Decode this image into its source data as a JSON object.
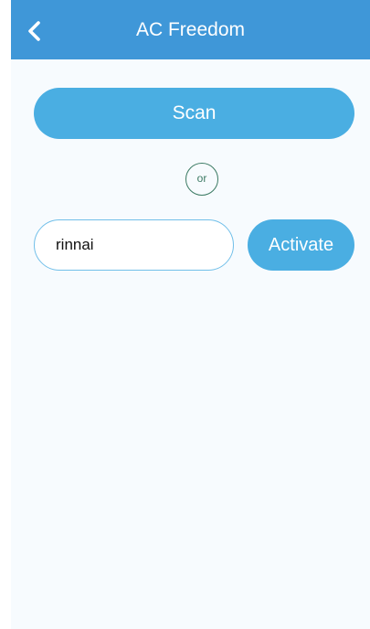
{
  "header": {
    "title": "AC Freedom",
    "back_icon": "chevron-left-icon"
  },
  "main": {
    "scan_label": "Scan",
    "or_label": "or",
    "code_input_value": "rinnai",
    "activate_label": "Activate"
  },
  "colors": {
    "topbar": "#3f97d8",
    "button": "#4aaee2",
    "input_border": "#71bfe9",
    "or_circle": "#3b7a63"
  }
}
